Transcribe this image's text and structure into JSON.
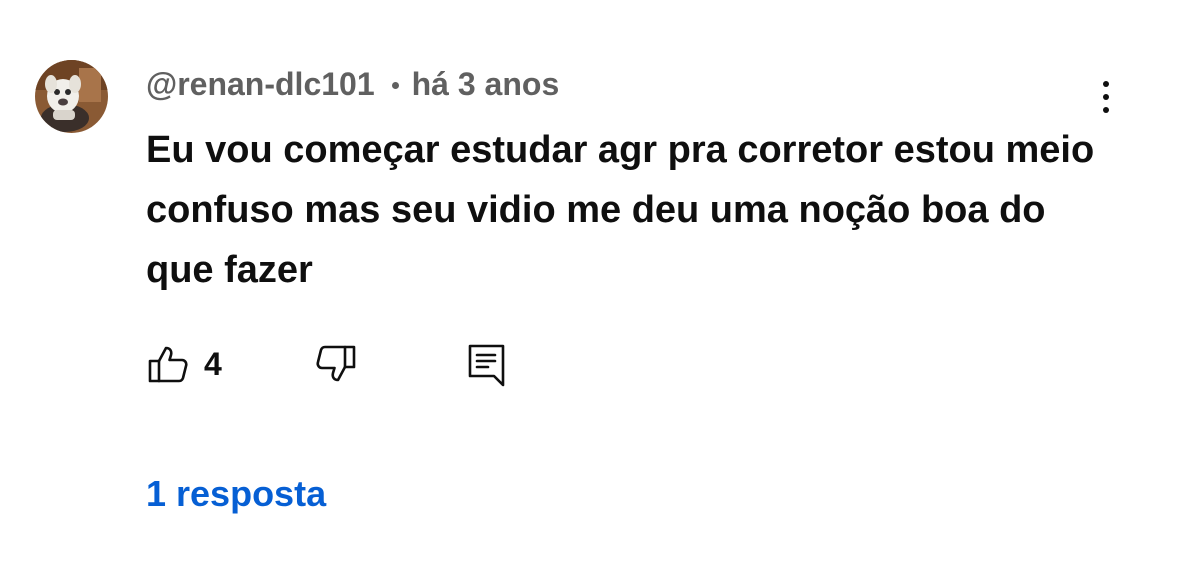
{
  "comment": {
    "author": "@renan-dlc101",
    "time": "há 3 anos",
    "text": "Eu vou começar estudar agr pra corretor estou meio confuso mas seu vidio me deu uma noção boa do que fazer",
    "likes": "4",
    "replies_label": "1 resposta"
  },
  "icons": {
    "avatar": "user-avatar-dog",
    "more": "more-vert-icon",
    "like": "thumb-up-icon",
    "dislike": "thumb-down-icon",
    "reply": "reply-comment-icon"
  },
  "colors": {
    "text": "#0f0f0f",
    "meta": "#606060",
    "link": "#065fd4",
    "background": "#ffffff"
  }
}
